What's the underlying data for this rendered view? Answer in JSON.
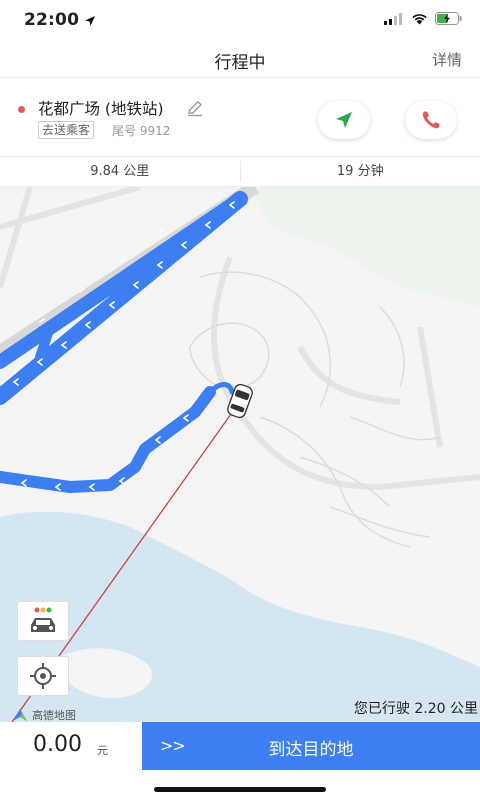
{
  "status_bar": {
    "time": "22:00"
  },
  "nav": {
    "title": "行程中",
    "detail": "详情"
  },
  "trip": {
    "destination": "花都广场 (地铁站)",
    "tag": "去送乘客",
    "tail_number": "尾号 9912"
  },
  "metrics": {
    "distance": "9.84 公里",
    "duration": "19 分钟"
  },
  "map": {
    "logo_text": "高德地图",
    "driven_text": "您已行驶 2.20 公里"
  },
  "fare": {
    "value": "0.00",
    "unit": "元"
  },
  "action": {
    "chevrons": ">>",
    "label": "到达目的地"
  },
  "colors": {
    "route": "#3d7ff2",
    "accent_green": "#2aa84a",
    "accent_red": "#e05a5a",
    "water": "#d4e6f1"
  }
}
